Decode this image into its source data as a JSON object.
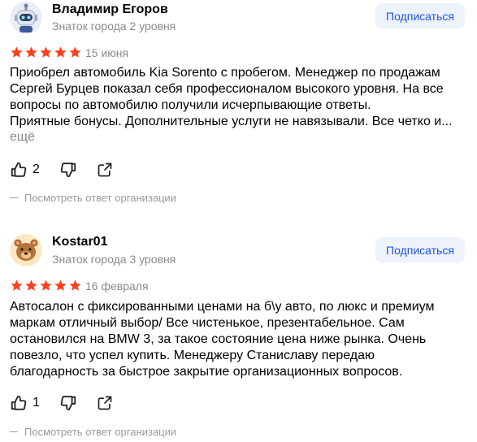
{
  "reviews": [
    {
      "author": "Владимир Егоров",
      "level": "Знаток города 2 уровня",
      "avatar_icon": "robot-avatar-icon",
      "subscribe_label": "Подписаться",
      "rating": 5,
      "date": "15 июня",
      "text": "Приобрел автомобиль Kia Sorento с пробегом. Менеджер по продажам\nСергей Бурцев показал себя профессионалом высокого уровня. На все\nвопросы по автомобилю получили исчерпывающие ответы.\nПриятные бонусы. Дополнительные услуги не навязывали. Все четко и...",
      "more_label": "ещё",
      "likes": "2",
      "org_reply_label": "Посмотреть ответ организации"
    },
    {
      "author": "Kostar01",
      "level": "Знаток города 3 уровня",
      "avatar_icon": "bear-avatar-icon",
      "subscribe_label": "Подписаться",
      "rating": 5,
      "date": "16 февраля",
      "text": "Автосалон с фиксированными ценами на б\\у авто, по люкс и премиум\nмаркам отличный выбор/ Все чистенькое, презентабельное. Сам\nостановился на BMW 3, за такое состояние цена ниже рынка. Очень\nповезло, что успел купить. Менеджеру Станиславу передаю\nблагодарность за быстрое закрытие организационных вопросов.",
      "likes": "1",
      "org_reply_label": "Посмотреть ответ организации"
    }
  ],
  "colors": {
    "star": "#fc3f1d",
    "accent": "#1c54e6",
    "button_bg": "#eef2fb",
    "muted": "#8a8a8a"
  }
}
